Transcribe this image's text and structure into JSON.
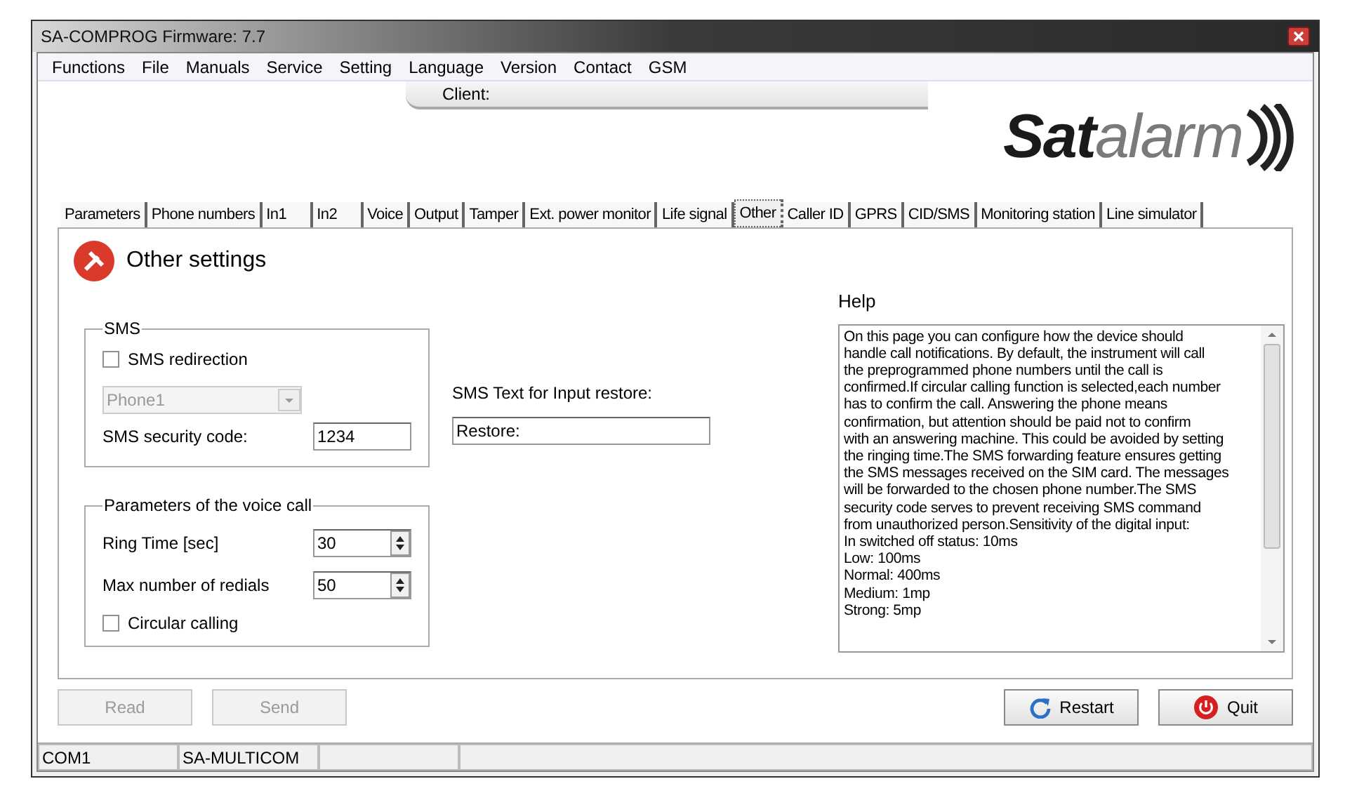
{
  "window": {
    "title": "SA-COMPROG Firmware: 7.7"
  },
  "menu": [
    "Functions",
    "File",
    "Manuals",
    "Service",
    "Setting",
    "Language",
    "Version",
    "Contact",
    "GSM"
  ],
  "client": {
    "label": "Client:"
  },
  "logo": {
    "dark": "Sat",
    "light": "alarm"
  },
  "tabs": [
    {
      "label": "Parameters",
      "selected": false
    },
    {
      "label": "Phone numbers",
      "selected": false
    },
    {
      "label": "In1",
      "selected": false
    },
    {
      "label": "In2",
      "selected": false
    },
    {
      "label": "Voice",
      "selected": false
    },
    {
      "label": "Output",
      "selected": false
    },
    {
      "label": "Tamper",
      "selected": false
    },
    {
      "label": "Ext. power monitor",
      "selected": false
    },
    {
      "label": "Life signal",
      "selected": false
    },
    {
      "label": "Other",
      "selected": true
    },
    {
      "label": "Caller ID",
      "selected": false
    },
    {
      "label": "GPRS",
      "selected": false
    },
    {
      "label": "CID/SMS",
      "selected": false
    },
    {
      "label": "Monitoring station",
      "selected": false
    },
    {
      "label": "Line simulator",
      "selected": false
    }
  ],
  "heading": "Other settings",
  "sms": {
    "title": "SMS",
    "redirection": {
      "label": "SMS redirection",
      "checked": false
    },
    "phone": {
      "value": "Phone1",
      "disabled": true
    },
    "security_label": "SMS security code:",
    "security_value": "1234"
  },
  "restore": {
    "label": "SMS Text for Input restore:",
    "value": "Restore:"
  },
  "voice": {
    "title": "Parameters of the voice call",
    "ring_label": "Ring Time [sec]",
    "ring_value": "30",
    "redials_label": "Max number of redials",
    "redials_value": "50",
    "circular": {
      "label": "Circular calling",
      "checked": false
    }
  },
  "help": {
    "label": "Help",
    "lines": [
      "On this page you can configure how the device should",
      "handle call notifications. By default, the instrument will call",
      "the preprogrammed phone numbers until the call is",
      "confirmed.If circular calling function is selected,each number",
      "has to confirm the call. Answering the phone means",
      "confirmation, but attention should be paid not to confirm",
      "with an answering machine. This could be avoided by setting",
      "the ringing time.The SMS forwarding feature ensures getting",
      "the SMS messages received on the SIM card. The messages",
      "will be forwarded to the chosen phone number.The SMS",
      "security code serves to prevent receiving SMS command",
      "from unauthorized person.Sensitivity of the digital input:",
      "In switched off status: 10ms",
      "Low: 100ms",
      "Normal: 400ms",
      "Medium: 1mp",
      "Strong: 5mp"
    ]
  },
  "buttons": [
    {
      "label": "Read",
      "kind": "plain",
      "disabled": true
    },
    {
      "label": "Send",
      "kind": "plain",
      "disabled": true
    },
    {
      "label": "Restart",
      "kind": "restart",
      "disabled": false
    },
    {
      "label": "Quit",
      "kind": "quit",
      "disabled": false
    }
  ],
  "status_bar": [
    "COM1",
    "SA-MULTICOM"
  ]
}
